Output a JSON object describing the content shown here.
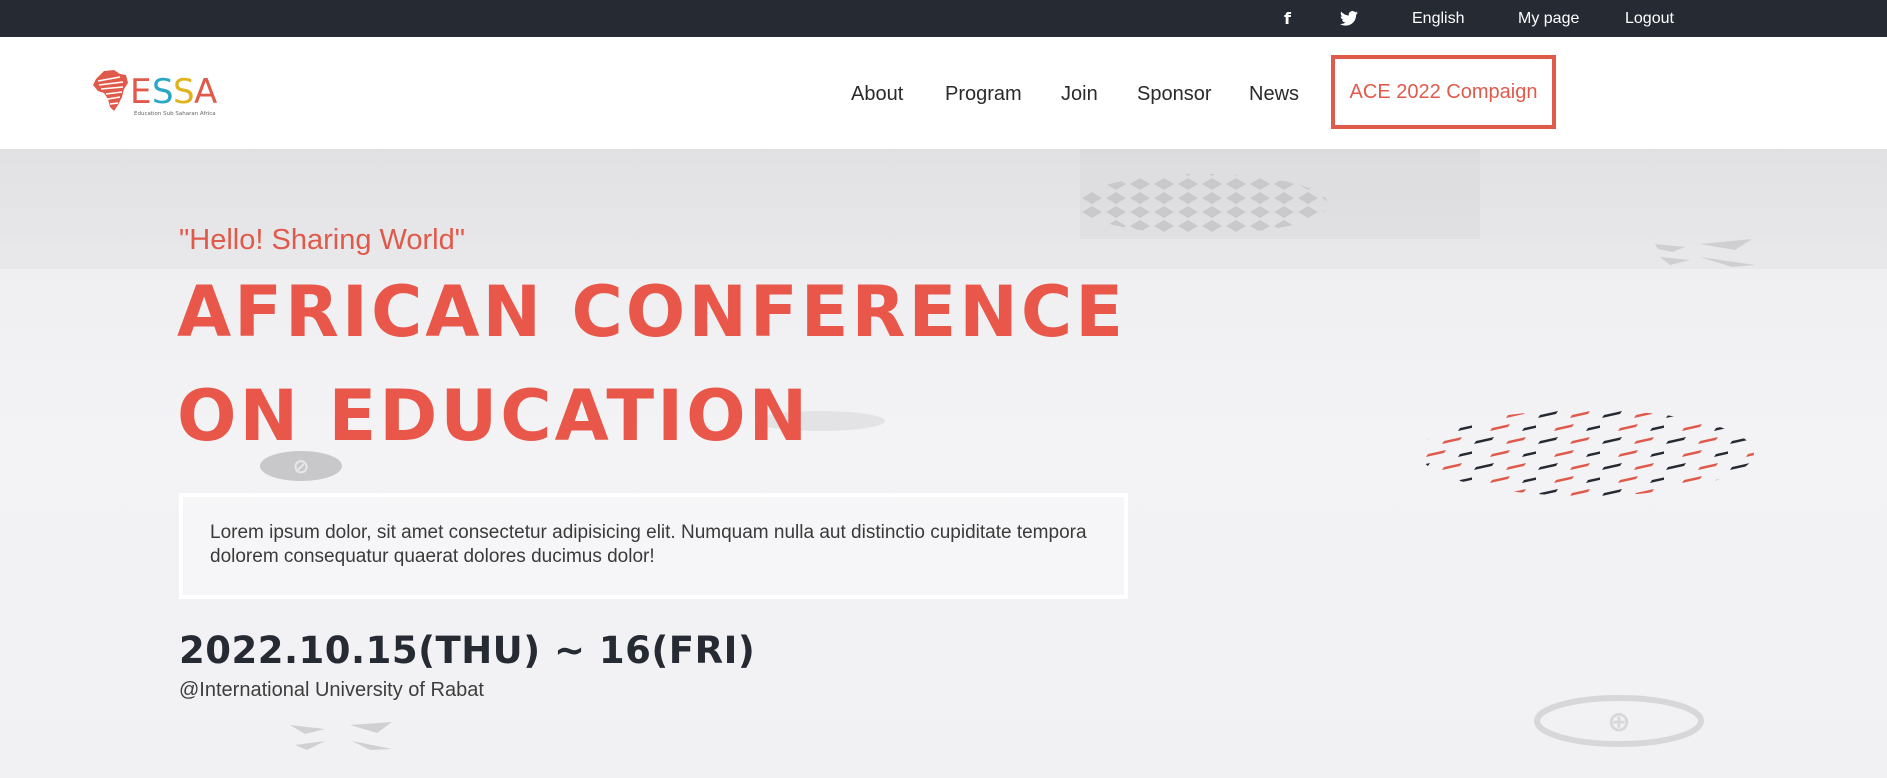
{
  "topbar": {
    "facebook_glyph": "f",
    "twitter_glyph": "🐦",
    "language": "English",
    "mypage": "My page",
    "logout": "Logout"
  },
  "logo": {
    "text": "ESSA",
    "subtitle": "Education Sub Saharan Africa"
  },
  "nav": {
    "about": "About",
    "program": "Program",
    "join": "Join",
    "sponsor": "Sponsor",
    "news": "News",
    "cta": "ACE 2022 Compaign"
  },
  "hero": {
    "tagline": "\"Hello! Sharing World\"",
    "title_line1": "AFRICAN CONFERENCE",
    "title_line2": "ON EDUCATION",
    "description": "Lorem ipsum dolor, sit amet consectetur adipisicing elit. Numquam nulla aut distinctio cupiditate tempora dolorem consequatur quaerat dolores ducimus dolor!",
    "date": "2022.10.15(THU) ~ 16(FRI)",
    "venue": "@International University of Rabat"
  },
  "colors": {
    "accent": "#e05a4b",
    "dark": "#262a33",
    "logo_blue": "#2aa6c8",
    "logo_yellow": "#e0b21c"
  }
}
